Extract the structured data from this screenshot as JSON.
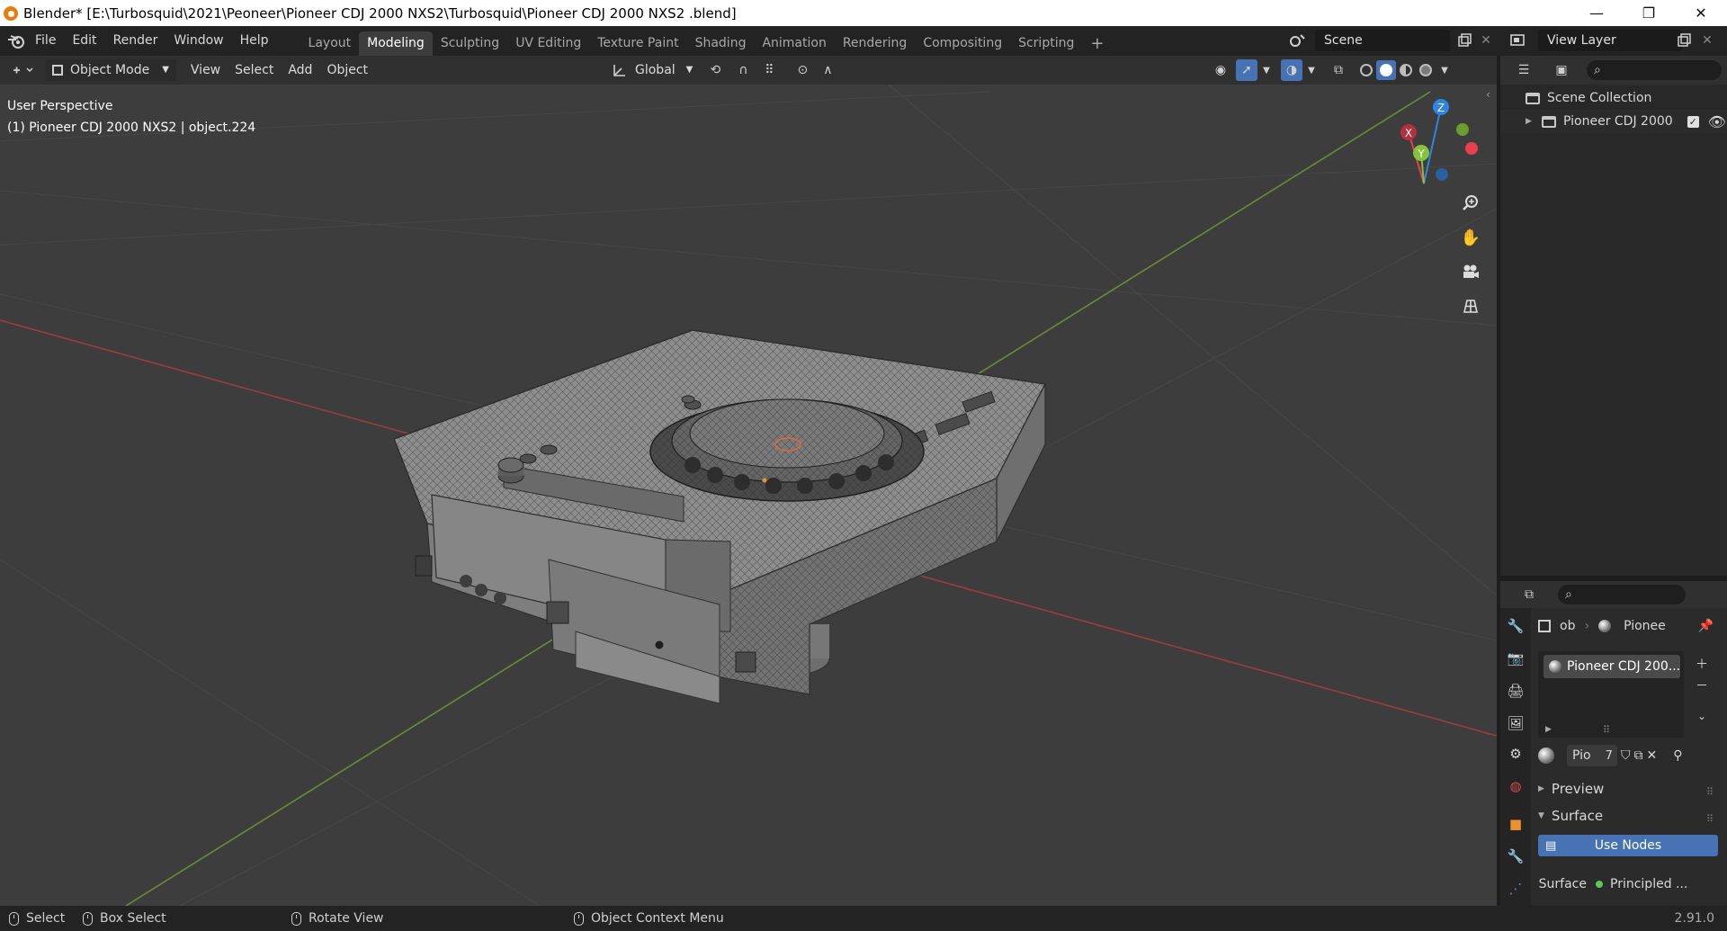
{
  "window": {
    "title": "Blender* [E:\\Turbosquid\\2021\\Peoneer\\Pioneer CDJ 2000 NXS2\\Turbosquid\\Pioneer CDJ 2000 NXS2 .blend]",
    "minimize": "—",
    "restore": "❐",
    "close": "✕"
  },
  "menu": {
    "items": [
      "File",
      "Edit",
      "Render",
      "Window",
      "Help"
    ]
  },
  "workspaces": {
    "tabs": [
      "Layout",
      "Modeling",
      "Sculpting",
      "UV Editing",
      "Texture Paint",
      "Shading",
      "Animation",
      "Rendering",
      "Compositing",
      "Scripting"
    ],
    "active": "Modeling",
    "add": "+"
  },
  "scene": {
    "name": "Scene"
  },
  "view_layer": {
    "name": "View Layer"
  },
  "viewport_header": {
    "mode": "Object Mode",
    "menus": [
      "View",
      "Select",
      "Add",
      "Object"
    ],
    "orientation": "Global"
  },
  "viewport": {
    "perspective": "User Perspective",
    "active_object": "(1) Pioneer CDJ 2000 NXS2  | object.224"
  },
  "gizmo": {
    "z": "Z",
    "x": "X",
    "y": "Y",
    "colors": {
      "x": "#e8404f",
      "y": "#84c33b",
      "z": "#2f84e3"
    }
  },
  "outliner": {
    "root": "Scene Collection",
    "items": [
      {
        "label": "Pioneer CDJ 2000"
      }
    ]
  },
  "properties": {
    "object_short": "ob",
    "material_short": "Pionee",
    "slot_name": "Pioneer CDJ 200...",
    "material_field": "Pio",
    "user_count": "7",
    "panels": {
      "preview": "Preview",
      "surface": "Surface"
    },
    "use_nodes": "Use Nodes",
    "surface_label": "Surface",
    "surface_value": "Principled ..."
  },
  "statusbar": {
    "select": "Select",
    "box_select": "Box Select",
    "rotate_view": "Rotate View",
    "context_menu": "Object Context Menu",
    "version": "2.91.0"
  }
}
